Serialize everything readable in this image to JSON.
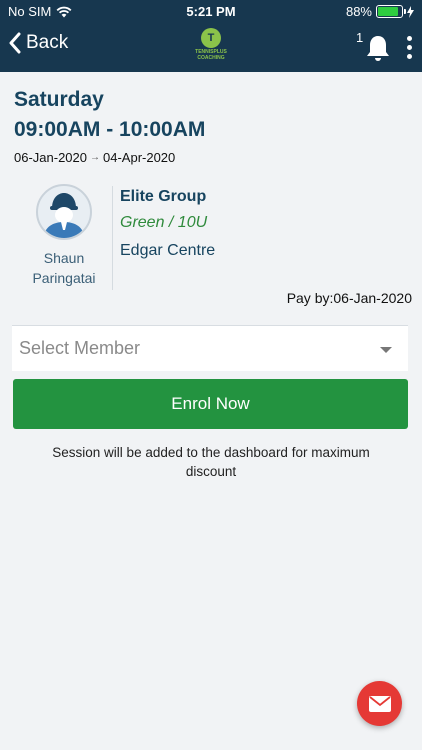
{
  "status_bar": {
    "carrier": "No SIM",
    "time": "5:21 PM",
    "battery": "88%",
    "battery_level": 0.88,
    "battery_fill_color": "#2ecc40"
  },
  "nav": {
    "back_label": "Back",
    "logo_text": "TENNISPLUS COACHING",
    "notification_count": "1",
    "icons": [
      "chevron-left-icon",
      "bell-icon",
      "more-vertical-icon"
    ]
  },
  "session": {
    "day": "Saturday",
    "time_range": "09:00AM - 10:00AM",
    "start_date": "06-Jan-2020",
    "arrow": "→",
    "end_date": "04-Apr-2020",
    "coach_first": "Shaun",
    "coach_last": "Paringatai",
    "group": "Elite Group",
    "level": "Green / 10U",
    "venue": "Edgar Centre",
    "pay_by": "Pay by:06-Jan-2020"
  },
  "form": {
    "select_placeholder": "Select Member",
    "enrol_label": "Enrol Now",
    "note": "Session will be added to the dashboard for maximum discount"
  },
  "colors": {
    "header_bg": "#17374f",
    "primary_text": "#17445f",
    "level_green": "#2f8a3c",
    "enrol_button": "#239340",
    "fab_red": "#e53935"
  },
  "fab": {
    "icon": "mail-icon"
  }
}
